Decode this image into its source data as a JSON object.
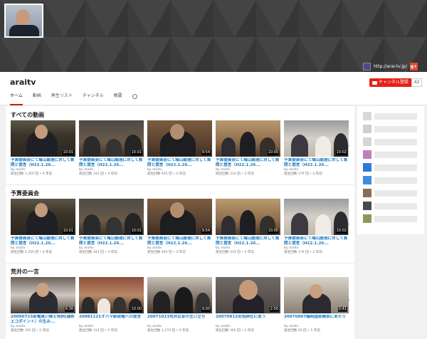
{
  "banner": {
    "link_text": "http://arai-tv.jp/",
    "gplus_label": "g+"
  },
  "channel": {
    "name": "araitv",
    "subscribe_label": "チャンネル登録",
    "subscriber_count": "42"
  },
  "tabs": [
    "ホーム",
    "動画",
    "再生リスト",
    "チャンネル",
    "概要"
  ],
  "sections": [
    {
      "title": "すべての動画",
      "videos": [
        {
          "title": "予算委員会にて鳩山総理に対して質問と提言（H22.1.26...",
          "by": "by araitv",
          "meta": "再生回数 1,350 回 • 4 年前",
          "duration": "10:01"
        },
        {
          "title": "予算委員会にて鳩山総理に対して質問と提言（H22.1.26...",
          "by": "by araitv",
          "meta": "再生回数 343 回 • 4 年前",
          "duration": "10:01"
        },
        {
          "title": "予算委員会にて鳩山総理に対して質問と提言（H22.1.26...",
          "by": "by araitv",
          "meta": "再生回数 645 回 • 4 年前",
          "duration": "9:54"
        },
        {
          "title": "予算委員会にて鳩山総理に対して質問と提言（H22.1.26...",
          "by": "by araitv",
          "meta": "再生回数 314 回 • 4 年前",
          "duration": "10:00"
        },
        {
          "title": "予算委員会にて鳩山総理に対して質問と提言（H22.1.26...",
          "by": "by araitv",
          "meta": "再生回数 179 回 • 4 年前",
          "duration": "10:02"
        }
      ]
    },
    {
      "title": "予算委員会",
      "videos": [
        {
          "title": "予算委員会にて鳩山総理に対して質問と提言（H22.1.26...",
          "by": "by araitv",
          "meta": "再生回数 1,350 回 • 4 年前",
          "duration": "10:01"
        },
        {
          "title": "予算委員会にて鳩山総理に対して質問と提言（H22.1.26...",
          "by": "by araitv",
          "meta": "再生回数 343 回 • 4 年前",
          "duration": "10:01"
        },
        {
          "title": "予算委員会にて鳩山総理に対して質問と提言（H22.1.26...",
          "by": "by araitv",
          "meta": "再生回数 645 回 • 4 年前",
          "duration": "9:54"
        },
        {
          "title": "予算委員会にて鳩山総理に対して質問と提言（H22.1.26...",
          "by": "by araitv",
          "meta": "再生回数 314 回 • 4 年前",
          "duration": "10:00"
        },
        {
          "title": "予算委員会にて鳩山総理に対して質問と提言（H22.1.26...",
          "by": "by araitv",
          "meta": "再生回数 179 回 • 4 年前",
          "duration": "10:02"
        }
      ]
    },
    {
      "title": "荒井の一言",
      "videos": [
        {
          "title": "20090723家電買い換え特例(通称エコポイント）の生み...",
          "by": "by araitv",
          "meta": "再生回数 391 回 • 5 年前",
          "duration": "6:36"
        },
        {
          "title": "20081121オバマ新政権への提言",
          "by": "by araitv",
          "meta": "再生回数 314 回 • 5 年前",
          "duration": "10:00"
        },
        {
          "title": "20071023荒井広幸の生い立ち",
          "by": "by araitv",
          "meta": "再生回数 1,270 回 • 5 年前",
          "duration": "9:00"
        },
        {
          "title": "20070912安倍辞任に思う",
          "by": "by araitv",
          "meta": "再生回数 305 回 • 5 年前",
          "duration": "2:56"
        },
        {
          "title": "20070807臨時国会開会にあたり",
          "by": "by araitv",
          "meta": "再生回数 26 回 • 5 年前",
          "duration": "0:41"
        }
      ]
    }
  ],
  "colors": {
    "accent": "#cc181e",
    "link": "#167ac6",
    "subscribe": "#e62117"
  }
}
